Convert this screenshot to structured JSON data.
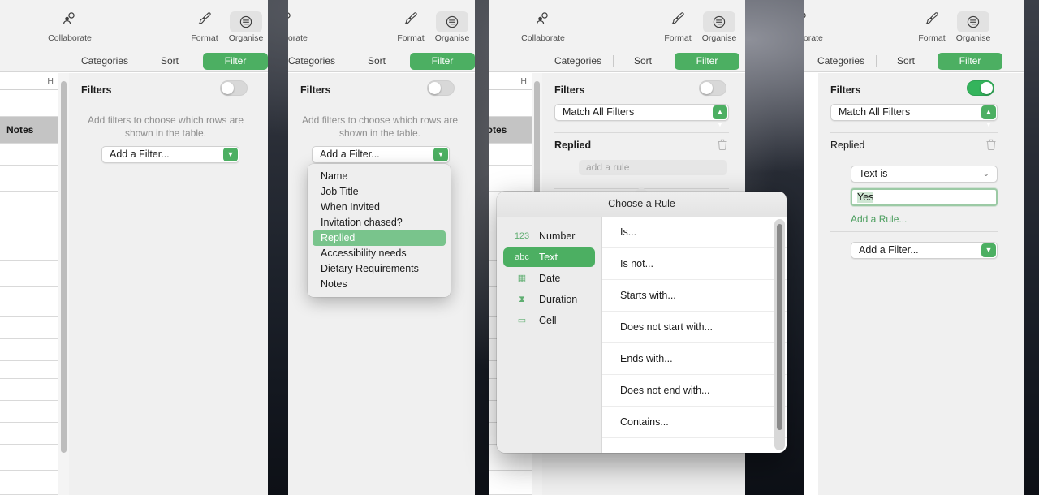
{
  "toolbar": {
    "collaborate_label": "Collaborate",
    "collaborate_icon": "collaborate-icon",
    "format_label": "Format",
    "format_icon": "paintbrush-icon",
    "organise_label": "Organise",
    "organise_icon": "organise-icon"
  },
  "segments": {
    "categories": "Categories",
    "sort": "Sort",
    "filter": "Filter"
  },
  "inspector": {
    "title": "Filters",
    "help_line1": "Add filters to choose which rows are",
    "help_line2": "shown in the table.",
    "add_filter": "Add a Filter...",
    "match_all": "Match All Filters",
    "column_name": "Replied",
    "add_rule_placeholder": "add a rule",
    "rule_condition": "Text is",
    "rule_value": "Yes",
    "add_a_rule": "Add a Rule...",
    "trash_icon": "trash-icon",
    "chevron_down_icon": "chevron-down-icon",
    "updown_icon": "up-down-chevron-icon"
  },
  "sheet": {
    "column_letter": "H",
    "notes_cell": "Notes"
  },
  "filter_menu": {
    "items": [
      {
        "label": "Name",
        "highlighted": false
      },
      {
        "label": "Job Title",
        "highlighted": false
      },
      {
        "label": "When Invited",
        "highlighted": false
      },
      {
        "label": "Invitation chased?",
        "highlighted": false
      },
      {
        "label": "Replied",
        "highlighted": true
      },
      {
        "label": "Accessibility needs",
        "highlighted": false
      },
      {
        "label": "Dietary Requirements",
        "highlighted": false
      },
      {
        "label": "Notes",
        "highlighted": false
      }
    ]
  },
  "choose_rule_dialog": {
    "title": "Choose a Rule",
    "types": [
      {
        "label": "Number",
        "icon": "123",
        "icon_name": "number-icon",
        "selected": false
      },
      {
        "label": "Text",
        "icon": "abc",
        "icon_name": "text-icon",
        "selected": true
      },
      {
        "label": "Date",
        "icon": "▦",
        "icon_name": "calendar-icon",
        "selected": false
      },
      {
        "label": "Duration",
        "icon": "⧗",
        "icon_name": "hourglass-icon",
        "selected": false
      },
      {
        "label": "Cell",
        "icon": "▭",
        "icon_name": "cell-icon",
        "selected": false
      }
    ],
    "rules": [
      "Is...",
      "Is not...",
      "Starts with...",
      "Does not start with...",
      "Ends with...",
      "Does not end with...",
      "Contains..."
    ]
  },
  "colors": {
    "accent_green": "#4caf62",
    "toggle_on_green": "#34b45c",
    "menu_highlight_green": "#79c48c",
    "link_green": "#4b9e5e",
    "panel_bg": "#f0f0f0",
    "toolbar_bg": "#f2f2f2"
  }
}
